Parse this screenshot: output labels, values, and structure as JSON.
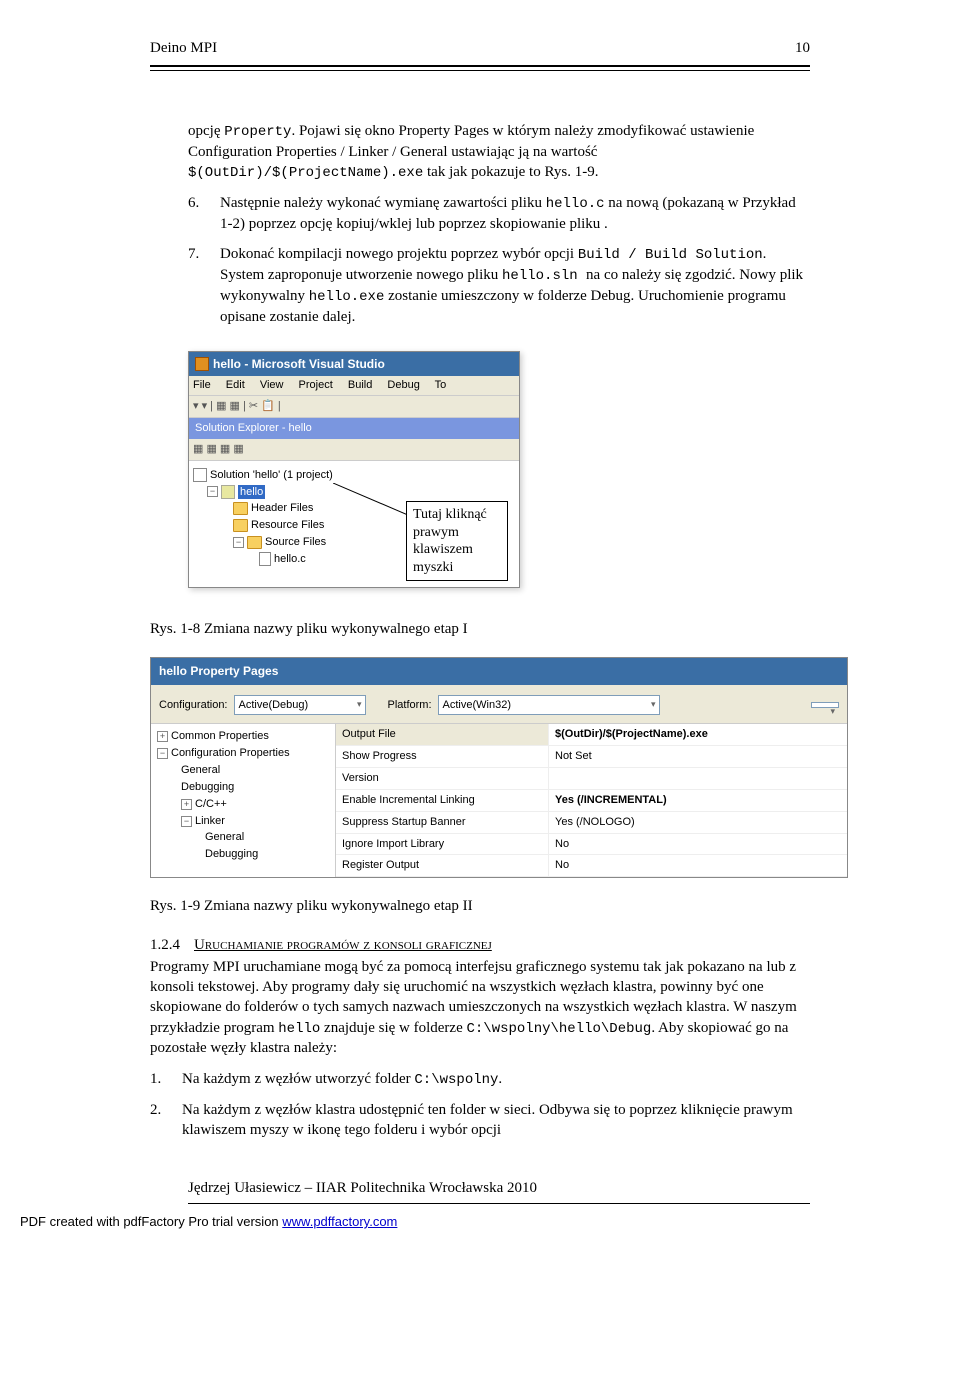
{
  "header": {
    "title": "Deino MPI",
    "page": "10"
  },
  "intro": {
    "pre": "opcję ",
    "code1": "Property",
    "t2": ". Pojawi się okno Property Pages w którym należy zmodyfikować ustawienie Configuration Properties / Linker / General ustawiając ją na wartość ",
    "code2": "$(OutDir)/$(ProjectName).exe",
    "t3": " tak jak pokazuje to Rys. 1-9."
  },
  "item6": {
    "num": "6.",
    "t1": "Następnie należy wykonać wymianę zawartości pliku ",
    "code1": "hello.c",
    "t2": " na nową (pokazaną w Przykład 1-2) poprzez opcję kopiuj/wklej lub poprzez skopiowanie pliku ."
  },
  "item7": {
    "num": "7.",
    "t1": "Dokonać kompilacji nowego projektu poprzez wybór opcji ",
    "code1": "Build / Build Solution",
    "t2": ". System zaproponuje utworzenie nowego pliku ",
    "code2": " hello.sln ",
    "t3": " na co należy się zgodzić. Nowy plik wykonywalny ",
    "code3": "hello.exe",
    "t4": " zostanie umieszczony w folderze Debug. Uruchomienie programu opisane zostanie dalej."
  },
  "vs": {
    "title": "hello - Microsoft Visual Studio",
    "menu": {
      "file": "File",
      "edit": "Edit",
      "view": "View",
      "project": "Project",
      "build": "Build",
      "debug": "Debug",
      "to": "To"
    },
    "tb": "▾ ▾ | ▦ ▦ | ✂ 📋 | ",
    "se": "Solution Explorer - hello",
    "tree": {
      "sol": "Solution 'hello' (1 project)",
      "proj": "hello",
      "hf": "Header Files",
      "rf": "Resource Files",
      "sf": "Source Files",
      "file": "hello.c"
    }
  },
  "annot": {
    "l1": "Tutaj kliknąć",
    "l2": "prawym",
    "l3": "klawiszem",
    "l4": "myszki"
  },
  "cap1": "Rys. 1-8 Zmiana nazwy pliku wykonywalnego etap I",
  "pp": {
    "title": "hello Property Pages",
    "config_label": "Configuration:",
    "config_val": "Active(Debug)",
    "platform_label": "Platform:",
    "platform_val": "Active(Win32)",
    "tree": {
      "cp": "Common Properties",
      "conf": "Configuration Properties",
      "gen": "General",
      "dbg": "Debugging",
      "cc": "C/C++",
      "lnk": "Linker",
      "lgen": "General",
      "ldbg": "Debugging"
    },
    "grid": [
      {
        "k": "Output File",
        "v": "$(OutDir)/$(ProjectName).exe"
      },
      {
        "k": "Show Progress",
        "v": "Not Set"
      },
      {
        "k": "Version",
        "v": ""
      },
      {
        "k": "Enable Incremental Linking",
        "v": "Yes (/INCREMENTAL)"
      },
      {
        "k": "Suppress Startup Banner",
        "v": "Yes (/NOLOGO)"
      },
      {
        "k": "Ignore Import Library",
        "v": "No"
      },
      {
        "k": "Register Output",
        "v": "No"
      }
    ]
  },
  "cap2": "Rys. 1-9  Zmiana nazwy pliku wykonywalnego etap II",
  "sec": {
    "num": "1.2.4",
    "title": "Uruchamianie programów z konsoli graficznej"
  },
  "para": {
    "t1": "Programy MPI uruchamiane mogą być za pomocą interfejsu graficznego systemu tak jak pokazano na lub z konsoli tekstowej. Aby programy dały się uruchomić na wszystkich węzłach klastra, powinny być one skopiowane do folderów o tych samych nazwach umieszczonych na wszystkich węzłach klastra. W naszym przykładzie program ",
    "c1": "hello",
    "t2": " znajduje się w folderze ",
    "c2": "C:\\wspolny\\hello\\Debug",
    "t3": ". Aby skopiować go na pozostałe węzły klastra należy:"
  },
  "steps": {
    "n1": "1.",
    "s1a": "Na każdym z węzłów utworzyć folder ",
    "s1c": "C:\\wspolny",
    "s1b": ".",
    "n2": "2.",
    "s2": "Na każdym z węzłów klastra udostępnić ten folder w sieci. Odbywa się to poprzez kliknięcie prawym klawiszem myszy w ikonę tego folderu i wybór opcji"
  },
  "footer": "Jędrzej Ułasiewicz – IIAR Politechnika Wrocławska      2010",
  "pdf": {
    "pre": "PDF created with pdfFactory Pro trial version ",
    "link": "www.pdffactory.com"
  }
}
